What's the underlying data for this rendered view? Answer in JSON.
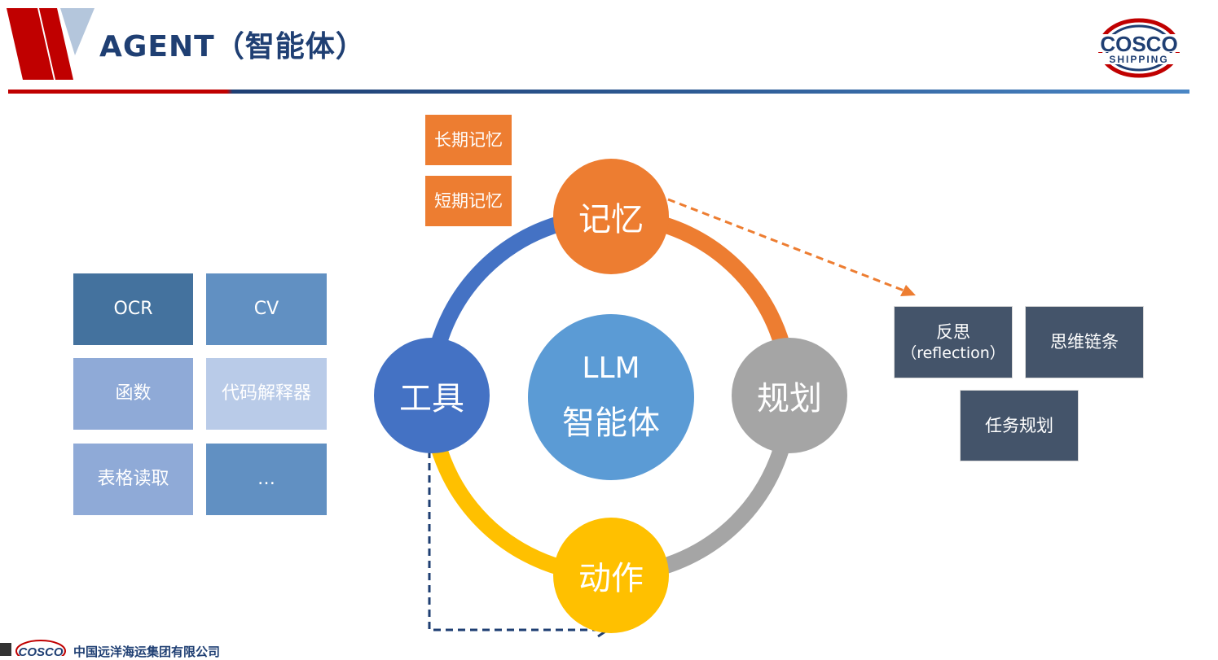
{
  "header": {
    "title": "AGENT（智能体）",
    "logo_text": "COSCO",
    "logo_subtext": "SHIPPING",
    "colors": {
      "red": "#c00000",
      "navy": "#1f3f73",
      "steel": "#8eaadb"
    }
  },
  "tools": {
    "items": [
      {
        "label": "OCR",
        "color": "#44729e"
      },
      {
        "label": "CV",
        "color": "#6190c2"
      },
      {
        "label": "函数",
        "color": "#8faad7"
      },
      {
        "label": "代码解释器",
        "color": "#b9cbe8"
      },
      {
        "label": "表格读取",
        "color": "#8faad7"
      },
      {
        "label": "…",
        "color": "#6190c2"
      }
    ]
  },
  "memory_types": [
    "长期记忆",
    "短期记忆"
  ],
  "cycle": {
    "memory": {
      "label": "记忆",
      "color": "#ed7d31"
    },
    "planning": {
      "label": "规划",
      "color": "#a5a5a5"
    },
    "action": {
      "label": "动作",
      "color": "#ffc000"
    },
    "tools": {
      "label": "工具",
      "color": "#4472c4"
    }
  },
  "center": {
    "line1": "LLM",
    "line2": "智能体",
    "color": "#5b9bd5"
  },
  "planning_items": {
    "reflection_line1": "反思",
    "reflection_line2": "（reflection）",
    "chain": "思维链条",
    "task": "任务规划"
  },
  "footer": {
    "company": "中国远洋海运集团有限公司"
  }
}
